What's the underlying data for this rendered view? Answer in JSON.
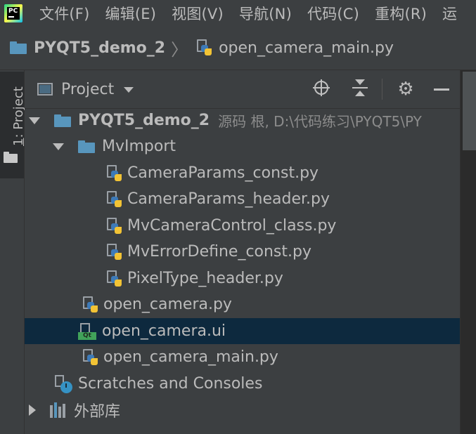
{
  "app": {
    "icon_text": "PC"
  },
  "menu": [
    "文件(F)",
    "编辑(E)",
    "视图(V)",
    "导航(N)",
    "代码(C)",
    "重构(R)",
    "运"
  ],
  "breadcrumb": {
    "project": "PYQT5_demo_2",
    "file": "open_camera_main.py"
  },
  "sidebar": {
    "tab_number": "1",
    "tab_rest": ": Project"
  },
  "panel": {
    "title": "Project"
  },
  "tree": {
    "root": {
      "name": "PYQT5_demo_2",
      "hint": "源码 根,  D:\\代码练习\\PYQT5\\PY"
    },
    "folder": {
      "name": "MvImport"
    },
    "folder_files": [
      "CameraParams_const.py",
      "CameraParams_header.py",
      "MvCameraControl_class.py",
      "MvErrorDefine_const.py",
      "PixelType_header.py"
    ],
    "root_files": [
      {
        "name": "open_camera.py",
        "type": "py"
      },
      {
        "name": "open_camera.ui",
        "type": "ui",
        "selected": true,
        "badge": "Qt"
      },
      {
        "name": "open_camera_main.py",
        "type": "py"
      }
    ],
    "scratches": "Scratches and Consoles",
    "external_libs": "外部库"
  },
  "colors": {
    "background": "#3c3f41",
    "selection": "#0d293e",
    "folder": "#5896bd",
    "python_blue": "#3d7ab8",
    "python_yellow": "#f2c335",
    "qt_green": "#41a35a"
  }
}
